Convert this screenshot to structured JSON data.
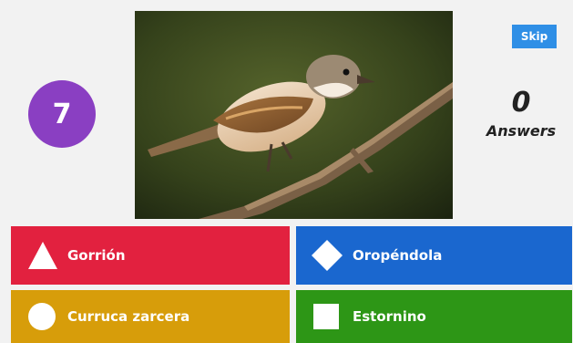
{
  "timer": {
    "value": "7",
    "color": "#8a3fc2"
  },
  "skip_button": {
    "label": "Skip",
    "color": "#2f8fe6"
  },
  "answers_counter": {
    "value": "0",
    "label": "Answers"
  },
  "question_image": {
    "subject": "bird on branch"
  },
  "options": [
    {
      "shape": "triangle",
      "label": "Gorrión",
      "color": "#e2213f"
    },
    {
      "shape": "diamond",
      "label": "Oropéndola",
      "color": "#1a67cf"
    },
    {
      "shape": "circle",
      "label": "Curruca zarcera",
      "color": "#d79d0a"
    },
    {
      "shape": "square",
      "label": "Estornino",
      "color": "#2d9616"
    }
  ]
}
